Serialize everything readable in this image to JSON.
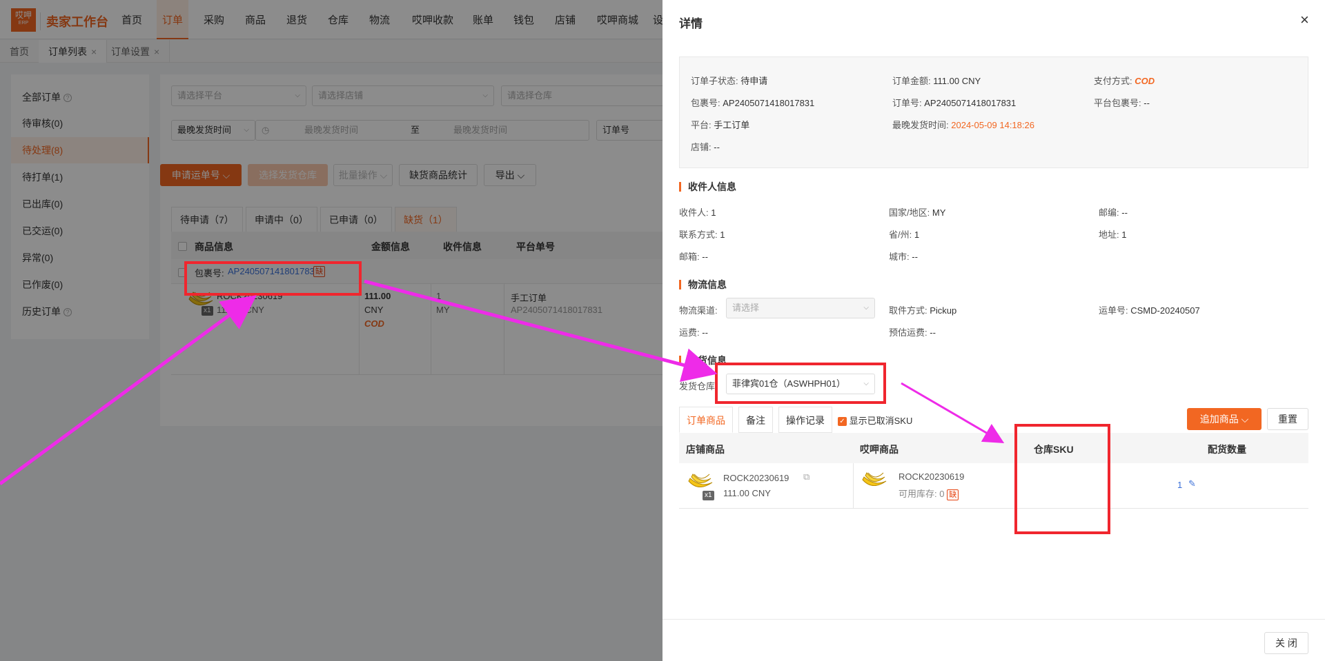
{
  "app": {
    "logo_text": "哎呷",
    "logo_sub": "ERP",
    "brand": "卖家工作台"
  },
  "nav": [
    "首页",
    "订单",
    "采购",
    "商品",
    "退货",
    "仓库",
    "物流",
    "哎呷收款",
    "账单",
    "钱包",
    "店铺",
    "哎呷商城",
    "设"
  ],
  "nav_active": "订单",
  "page_tabs": [
    {
      "label": "首页",
      "closable": false
    },
    {
      "label": "订单列表",
      "closable": true
    },
    {
      "label": "订单设置",
      "closable": true
    }
  ],
  "close_glyph": "×",
  "sidebar": [
    {
      "label": "全部订单",
      "help": true
    },
    {
      "label": "待审核(0)"
    },
    {
      "label": "待处理(8)",
      "active": true
    },
    {
      "label": "待打单(1)"
    },
    {
      "label": "已出库(0)"
    },
    {
      "label": "已交运(0)"
    },
    {
      "label": "异常(0)"
    },
    {
      "label": "已作废(0)"
    },
    {
      "label": "历史订单",
      "help": true
    }
  ],
  "help_glyph": "?",
  "filters": {
    "platform": "请选择平台",
    "shop": "请选择店铺",
    "warehouse": "请选择仓库",
    "time_type": "最晚发货时间",
    "start": "最晚发货时间",
    "to": "至",
    "end": "最晚发货时间",
    "order_no": "订单号"
  },
  "actions": {
    "apply": "申请运单号",
    "select_wh": "选择发货仓库",
    "batch": "批量操作",
    "shortage": "缺货商品统计",
    "export": "导出"
  },
  "status_tabs": [
    "待申请（7）",
    "申请中（0）",
    "已申请（0）",
    "缺货（1）"
  ],
  "table": {
    "headers": [
      "商品信息",
      "金额信息",
      "收件信息",
      "平台单号"
    ],
    "package_label": "包裹号:",
    "package_no": "AP2405071418017831",
    "shortage_tag": "缺",
    "product": {
      "sku": "ROCK20230619",
      "price": "111.00 CNY",
      "qty": "x1"
    },
    "amount": "111.00",
    "currency": "CNY",
    "pay": "COD",
    "recv_qty": "1",
    "recv_country": "MY",
    "platform_type": "手工订单",
    "platform_no": "AP2405071418017831"
  },
  "drawer": {
    "title": "详情",
    "close": "×",
    "info": {
      "substatus_k": "订单子状态:",
      "substatus_v": "待申请",
      "amount_k": "订单金额:",
      "amount_v": "111.00 CNY",
      "paymethod_k": "支付方式:",
      "paymethod_v": "COD",
      "pkg_k": "包裹号:",
      "pkg_v": "AP2405071418017831",
      "order_k": "订单号:",
      "order_v": "AP2405071418017831",
      "ppkg_k": "平台包裹号:",
      "ppkg_v": "--",
      "platform_k": "平台:",
      "platform_v": "手工订单",
      "latest_k": "最晚发货时间:",
      "latest_v": "2024-05-09 14:18:26",
      "shop_k": "店铺:",
      "shop_v": "--"
    },
    "receiver": {
      "title": "收件人信息",
      "name_k": "收件人:",
      "name_v": "1",
      "country_k": "国家/地区:",
      "country_v": "MY",
      "zip_k": "邮编:",
      "zip_v": "--",
      "contact_k": "联系方式:",
      "contact_v": "1",
      "province_k": "省/州:",
      "province_v": "1",
      "addr_k": "地址:",
      "addr_v": "1",
      "email_k": "邮箱:",
      "email_v": "--",
      "city_k": "城市:",
      "city_v": "--"
    },
    "logistics": {
      "title": "物流信息",
      "channel_k": "物流渠道:",
      "channel_v": "请选择",
      "pickup_k": "取件方式:",
      "pickup_v": "Pickup",
      "waybill_k": "运单号:",
      "waybill_v": "CSMD-20240507",
      "fee_k": "运费:",
      "fee_v": "--",
      "est_k": "预估运费:",
      "est_v": "--"
    },
    "shipping": {
      "title": "发货信息",
      "wh_k": "发货仓库",
      "wh_v": "菲律宾01仓（ASWHPH01）"
    },
    "tabs": [
      "订单商品",
      "备注",
      "操作记录"
    ],
    "show_cancelled": "显示已取消SKU",
    "add_product": "追加商品",
    "reset": "重置",
    "cols": [
      "店铺商品",
      "哎呷商品",
      "仓库SKU",
      "配货数量"
    ],
    "row": {
      "shop_sku": "ROCK20230619",
      "shop_price": "111.00 CNY",
      "qty_badge": "x1",
      "ay_sku": "ROCK20230619",
      "stock_k": "可用库存:",
      "stock_v": "0",
      "shortage": "缺",
      "alloc": "1"
    },
    "footer_close": "关 闭"
  }
}
